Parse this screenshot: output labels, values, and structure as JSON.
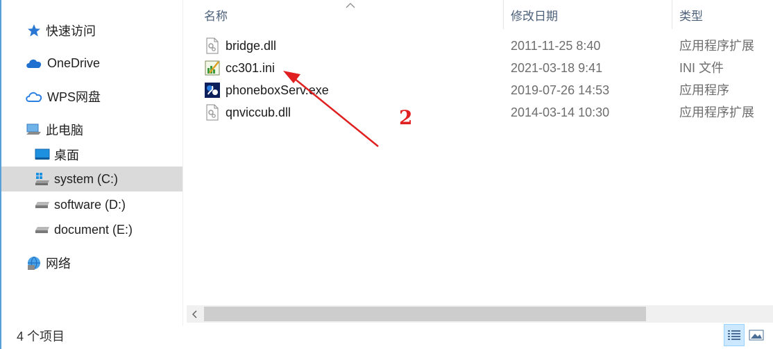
{
  "navigation": {
    "items": [
      {
        "label": "快速访问",
        "icon": "star-icon"
      },
      {
        "label": "OneDrive",
        "icon": "cloud-icon"
      },
      {
        "label": "WPS网盘",
        "icon": "cloud-outline-icon"
      },
      {
        "label": "此电脑",
        "icon": "computer-icon"
      },
      {
        "label": "桌面",
        "icon": "desktop-icon"
      },
      {
        "label": "system (C:)",
        "icon": "windows-drive-icon"
      },
      {
        "label": "software (D:)",
        "icon": "drive-icon"
      },
      {
        "label": "document (E:)",
        "icon": "drive-icon"
      },
      {
        "label": "网络",
        "icon": "network-icon"
      }
    ],
    "selected": "system (C:)"
  },
  "columns": {
    "name": "名称",
    "modified": "修改日期",
    "type": "类型"
  },
  "files": [
    {
      "name": "bridge.dll",
      "modified": "2011-11-25 8:40",
      "type": "应用程序扩展",
      "icon": "dll-file-icon"
    },
    {
      "name": "cc301.ini",
      "modified": "2021-03-18 9:41",
      "type": "INI 文件",
      "icon": "ini-file-icon"
    },
    {
      "name": "phoneboxServ.exe",
      "modified": "2019-07-26 14:53",
      "type": "应用程序",
      "icon": "exe-app-icon"
    },
    {
      "name": "qnviccub.dll",
      "modified": "2014-03-14 10:30",
      "type": "应用程序扩展",
      "icon": "dll-file-icon"
    }
  ],
  "status": {
    "item_count": "4 个项目"
  },
  "annotation": {
    "label": "2",
    "color": "#e02020"
  },
  "colors": {
    "selected_bg": "#dadada",
    "accent": "#5a9fd6",
    "header_text": "#4c607a"
  }
}
